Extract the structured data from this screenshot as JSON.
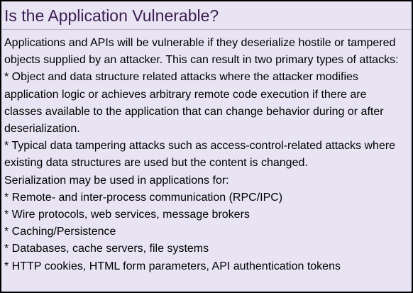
{
  "panel": {
    "title": "Is the Application Vulnerable?",
    "lines": [
      "Applications and APIs will be vulnerable if they deserialize hostile or tampered",
      "objects supplied by an attacker. This can result in two primary types of attacks:",
      "* Object and data structure related attacks where the attacker modifies",
      "application logic or achieves arbitrary remote code execution if there are",
      "classes available to the application that can change behavior during or after",
      "deserialization.",
      "* Typical data tampering attacks such as access-control-related attacks where",
      "existing data structures are used but the content is changed.",
      "Serialization may be used in applications for:",
      "* Remote- and inter-process communication (RPC/IPC)",
      "* Wire protocols, web services, message brokers",
      "* Caching/Persistence",
      "* Databases, cache servers, file systems",
      "* HTTP cookies, HTML form parameters, API authentication tokens"
    ]
  },
  "colors": {
    "background": "#e8e4f4",
    "title": "#3a1d4f",
    "border": "#000000"
  }
}
